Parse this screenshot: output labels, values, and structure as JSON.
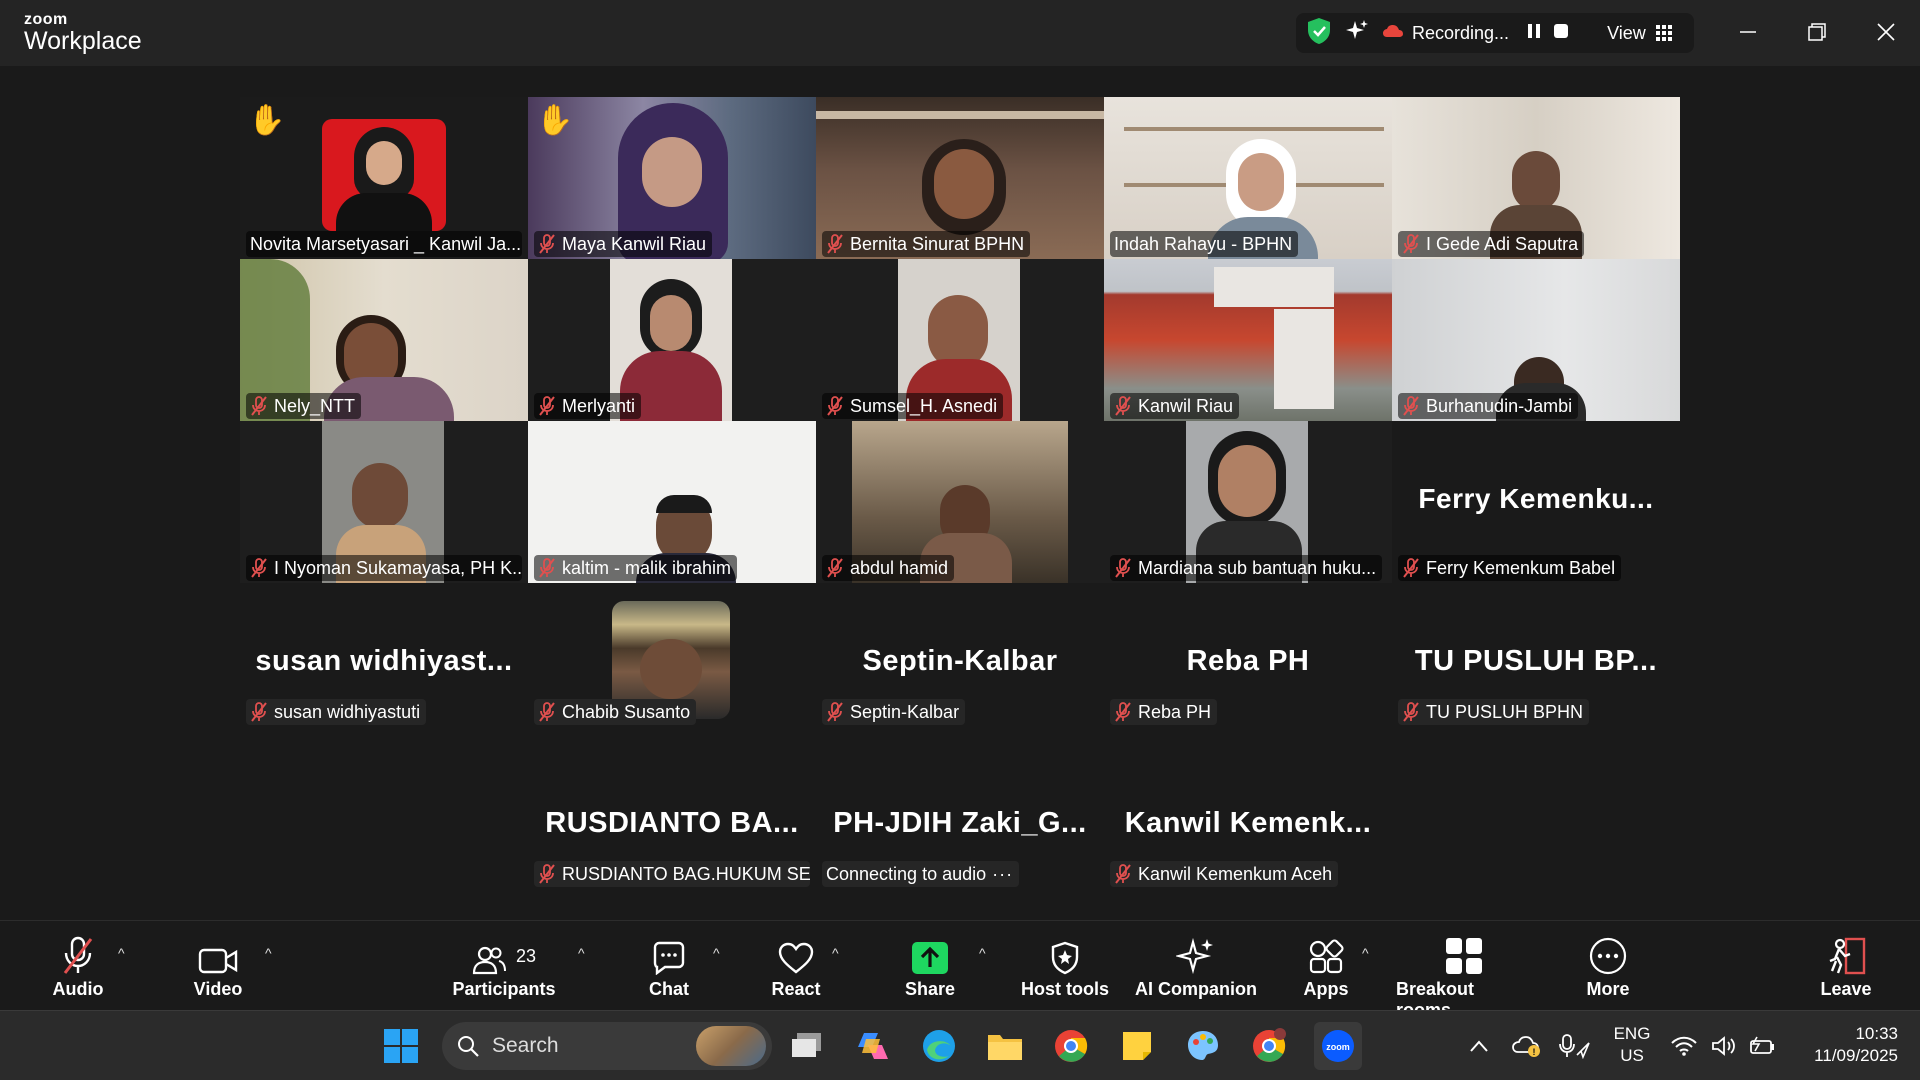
{
  "window": {
    "logo_line1": "zoom",
    "logo_line2": "Workplace",
    "recording_label": "Recording...",
    "view_label": "View"
  },
  "tiles": [
    {
      "name": "Novita Marsetyasari _ Kanwil Ja...",
      "video": true,
      "hand": true,
      "active": true,
      "muted": false
    },
    {
      "name": "Maya Kanwil Riau",
      "video": true,
      "hand": true,
      "muted": true
    },
    {
      "name": "Bernita Sinurat BPHN",
      "video": true,
      "muted": true
    },
    {
      "name": "Indah Rahayu - BPHN",
      "video": true,
      "muted": false
    },
    {
      "name": "I Gede Adi Saputra",
      "video": true,
      "muted": true
    },
    {
      "name": "Nely_NTT",
      "video": true,
      "muted": true
    },
    {
      "name": "Merlyanti",
      "video": true,
      "muted": true
    },
    {
      "name": "Sumsel_H. Asnedi",
      "video": true,
      "muted": true
    },
    {
      "name": "Kanwil Riau",
      "video": true,
      "muted": true
    },
    {
      "name": "Burhanudin-Jambi",
      "video": true,
      "muted": true
    },
    {
      "name": "I Nyoman Sukamayasa, PH K...",
      "video": true,
      "muted": true
    },
    {
      "name": "kaltim - malik ibrahim",
      "video": true,
      "muted": true
    },
    {
      "name": "abdul hamid",
      "video": true,
      "muted": true
    },
    {
      "name": "Mardiana sub bantuan huku...",
      "video": true,
      "muted": true
    },
    {
      "name": "Ferry Kemenkum Babel",
      "big_name": "Ferry  Kemenku...",
      "video": false,
      "muted": true
    },
    {
      "name": "susan widhiyastuti",
      "big_name": "susan  widhiyast...",
      "video": false,
      "muted": true
    },
    {
      "name": "Chabib Susanto",
      "video": true,
      "muted": true
    },
    {
      "name": "Septin-Kalbar",
      "big_name": "Septin-Kalbar",
      "video": false,
      "muted": true
    },
    {
      "name": "Reba PH",
      "big_name": "Reba PH",
      "video": false,
      "muted": true
    },
    {
      "name": "TU PUSLUH BPHN",
      "big_name": "TU PUSLUH  BP...",
      "video": false,
      "muted": true
    },
    {
      "name": "RUSDIANTO BAG.HUKUM SE...",
      "big_name": "RUSDIANTO  BA...",
      "video": false,
      "muted": true
    },
    {
      "name": "Connecting to audio",
      "big_name": "PH-JDIH  Zaki_G...",
      "video": false,
      "muted": false,
      "connecting": true
    },
    {
      "name": "Kanwil Kemenkum Aceh",
      "big_name": "Kanwil  Kemenk...",
      "video": false,
      "muted": true
    }
  ],
  "toolbar": {
    "audio": "Audio",
    "video": "Video",
    "participants": "Participants",
    "participants_count": "23",
    "chat": "Chat",
    "react": "React",
    "share": "Share",
    "host_tools": "Host tools",
    "ai_companion": "AI Companion",
    "apps": "Apps",
    "breakout_rooms": "Breakout rooms",
    "more": "More",
    "leave": "Leave"
  },
  "taskbar": {
    "search_placeholder": "Search",
    "lang1": "ENG",
    "lang2": "US",
    "time": "10:33",
    "date": "11/09/2025"
  },
  "colors": {
    "active_speaker": "#2ad06c",
    "muted_icon": "#e0504f",
    "share_green": "#1ed760",
    "zoom_blue": "#0b5cff"
  }
}
